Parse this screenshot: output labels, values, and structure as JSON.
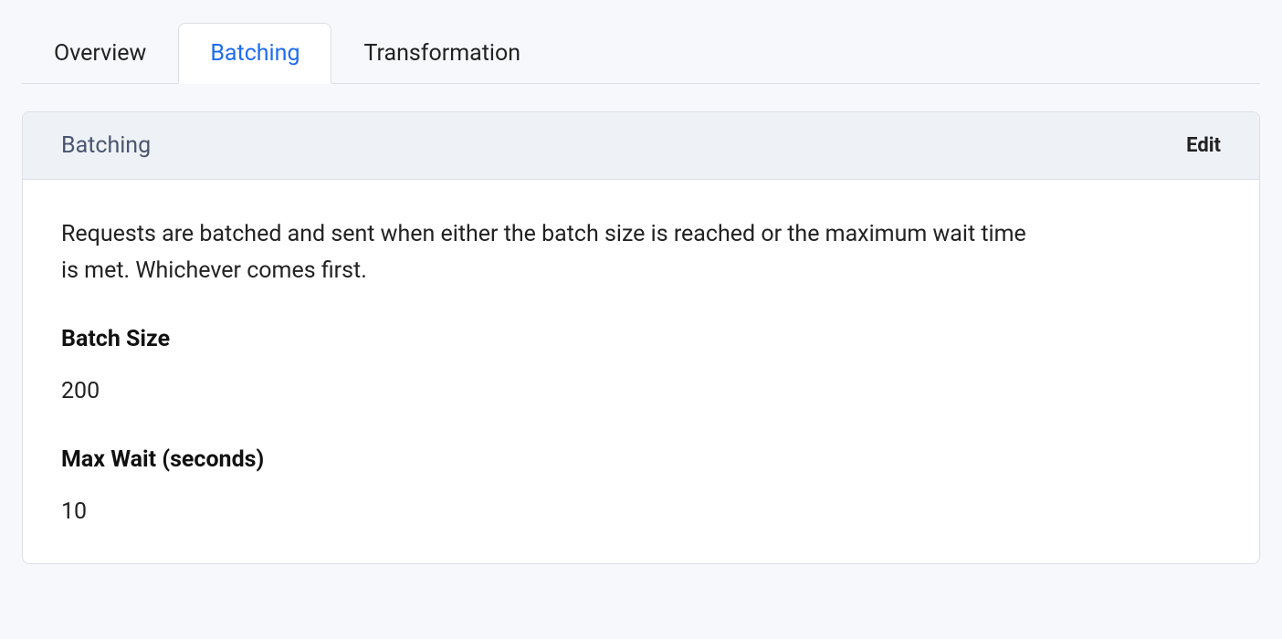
{
  "tabs": [
    {
      "label": "Overview",
      "active": false
    },
    {
      "label": "Batching",
      "active": true
    },
    {
      "label": "Transformation",
      "active": false
    }
  ],
  "panel": {
    "title": "Batching",
    "edit_label": "Edit",
    "description": "Requests are batched and sent when either the batch size is reached or the maximum wait time is met. Whichever comes first.",
    "fields": [
      {
        "label": "Batch Size",
        "value": "200"
      },
      {
        "label": "Max Wait (seconds)",
        "value": "10"
      }
    ]
  }
}
